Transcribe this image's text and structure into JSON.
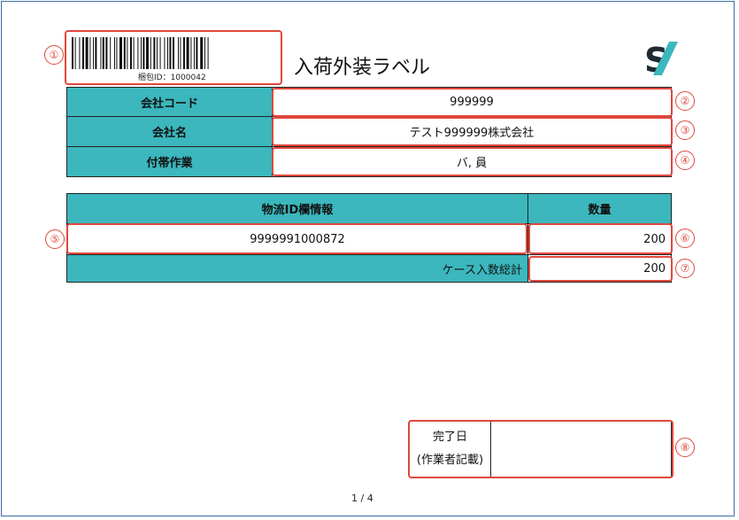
{
  "title": "入荷外装ラベル",
  "barcode": {
    "caption": "梱包ID：1000042"
  },
  "logo": {
    "name": "s-slash-logo",
    "colors": {
      "s": "#1f2a33",
      "slash": "#3bb7bd"
    }
  },
  "company": {
    "code_label": "会社コード",
    "code_value": "999999",
    "name_label": "会社名",
    "name_value": "テスト999999株式会社",
    "work_label": "付帯作業",
    "work_value": "バ, 員"
  },
  "logistics": {
    "id_header": "物流ID欄情報",
    "qty_header": "数量",
    "id_value": "9999991000872",
    "qty_value": "200",
    "total_label": "ケース入数総計",
    "total_value": "200"
  },
  "completion": {
    "label_line1": "完了日",
    "label_line2": "(作業者記載)",
    "value": ""
  },
  "page_indicator": "1 / 4",
  "markers": [
    "①",
    "②",
    "③",
    "④",
    "⑤",
    "⑥",
    "⑦",
    "⑧"
  ],
  "colors": {
    "teal": "#3bb7bd",
    "marker_red": "#e0473c",
    "frame_blue": "#3d6da8"
  }
}
